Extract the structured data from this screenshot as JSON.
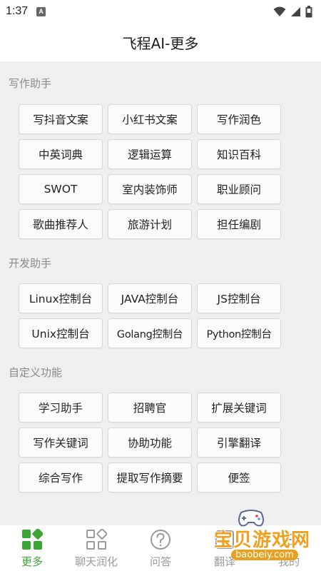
{
  "status_bar": {
    "time": "1:37",
    "notif_letter": "A"
  },
  "header": {
    "title": "飞程AI-更多"
  },
  "sections": [
    {
      "title": "写作助手",
      "items": [
        "写抖音文案",
        "小红书文案",
        "写作润色",
        "中英词典",
        "逻辑运算",
        "知识百科",
        "SWOT",
        "室内装饰师",
        "职业顾问",
        "歌曲推荐人",
        "旅游计划",
        "担任编剧"
      ]
    },
    {
      "title": "开发助手",
      "items": [
        "Linux控制台",
        "JAVA控制台",
        "JS控制台",
        "Unix控制台",
        "Golang控制台",
        "Python控制台"
      ]
    },
    {
      "title": "自定义功能",
      "items": [
        "学习助手",
        "招聘官",
        "扩展关键词",
        "写作关键词",
        "协助功能",
        "引擎翻译",
        "综合写作",
        "提取写作摘要",
        "便签"
      ]
    }
  ],
  "bottom_nav": {
    "items": [
      {
        "label": "更多",
        "icon": "grid-icon",
        "active": true
      },
      {
        "label": "聊天润化",
        "icon": "apps-icon",
        "active": false
      },
      {
        "label": "问答",
        "icon": "question-icon",
        "active": false
      },
      {
        "label": "翻译",
        "icon": "translate-icon",
        "active": false
      },
      {
        "label": "我的",
        "icon": "profile-icon",
        "active": false
      }
    ]
  },
  "watermark": {
    "text": "宝贝游戏网",
    "url": "baobeiy.com"
  },
  "colors": {
    "accent": "#3aa635",
    "content_bg": "#efefef",
    "section_title": "#8a8a8a",
    "watermark": "#f0a020"
  }
}
